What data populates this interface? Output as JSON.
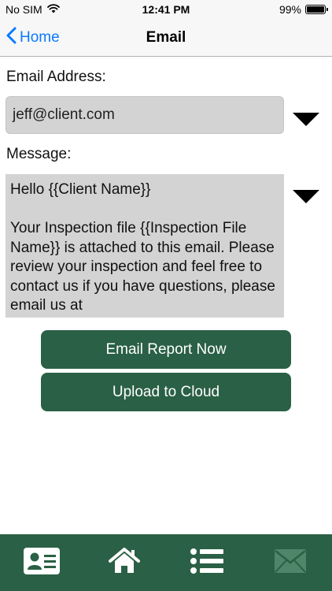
{
  "status_bar": {
    "carrier": "No SIM",
    "time": "12:41 PM",
    "battery_text": "99%",
    "battery_level": 0.99
  },
  "nav": {
    "back_label": "Home",
    "title": "Email"
  },
  "form": {
    "email_label": "Email Address:",
    "email_value": "jeff@client.com",
    "message_label": "Message:",
    "message_value": "Hello {{Client Name}}\n\nYour Inspection file {{Inspection File Name}} is attached to this email. Please review your inspection and feel free to contact us if you have questions, please email us at"
  },
  "buttons": {
    "email_report": "Email Report Now",
    "upload_cloud": "Upload to Cloud"
  },
  "tab_bar": {
    "tabs": [
      "contact-card-icon",
      "home-icon",
      "list-icon",
      "mail-icon"
    ],
    "active_tab": "mail-icon"
  },
  "colors": {
    "brand_green": "#2a6045",
    "ios_blue": "#0a7aff",
    "field_gray": "#d3d3d3",
    "inactive_tab": "#4f8568"
  }
}
